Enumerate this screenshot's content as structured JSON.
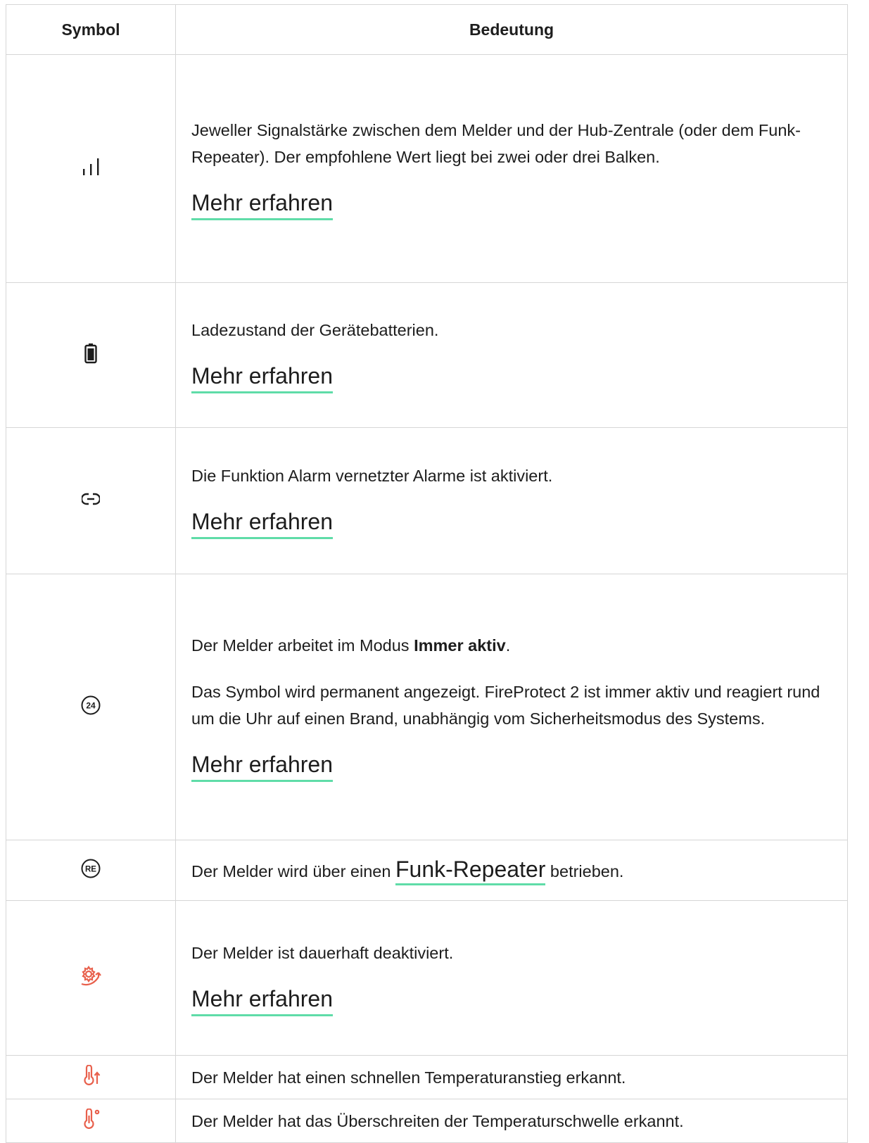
{
  "table": {
    "headers": {
      "symbol": "Symbol",
      "meaning": "Bedeutung"
    },
    "more_label": "Mehr erfahren",
    "rows": [
      {
        "icon": "signal-strength-icon",
        "text": "Jeweller Signalstärke zwischen dem Melder und der Hub-Zentrale (oder dem Funk-Repeater). Der empfohlene Wert liegt bei zwei oder drei Balken."
      },
      {
        "icon": "battery-icon",
        "text": "Ladezustand der Gerätebatterien."
      },
      {
        "icon": "link-icon",
        "text": "Die Funktion Alarm vernetzter Alarme ist aktiviert."
      },
      {
        "icon": "always-active-24-icon",
        "text_pre": "Der Melder arbeitet im Modus ",
        "text_bold": "Immer aktiv",
        "text_post": ".",
        "text2": "Das Symbol wird permanent angezeigt. FireProtect 2 ist immer aktiv und reagiert rund um die Uhr auf einen Brand, unabhängig vom Sicherheitsmodus des Systems."
      },
      {
        "icon": "range-extender-re-icon",
        "text_pre": "Der Melder wird über einen ",
        "link": "Funk-Repeater",
        "text_post": " betrieben."
      },
      {
        "icon": "permanently-deactivated-icon",
        "text": "Der Melder ist dauerhaft deaktiviert."
      },
      {
        "icon": "temperature-rise-icon",
        "text": "Der Melder hat einen schnellen Temperaturanstieg erkannt."
      },
      {
        "icon": "temperature-threshold-icon",
        "text": "Der Melder hat das Überschreiten der Temperaturschwelle erkannt."
      }
    ]
  },
  "colors": {
    "accent_underline": "#5fdca8",
    "alert_icon": "#e8604c",
    "border": "#d6d6d6"
  }
}
